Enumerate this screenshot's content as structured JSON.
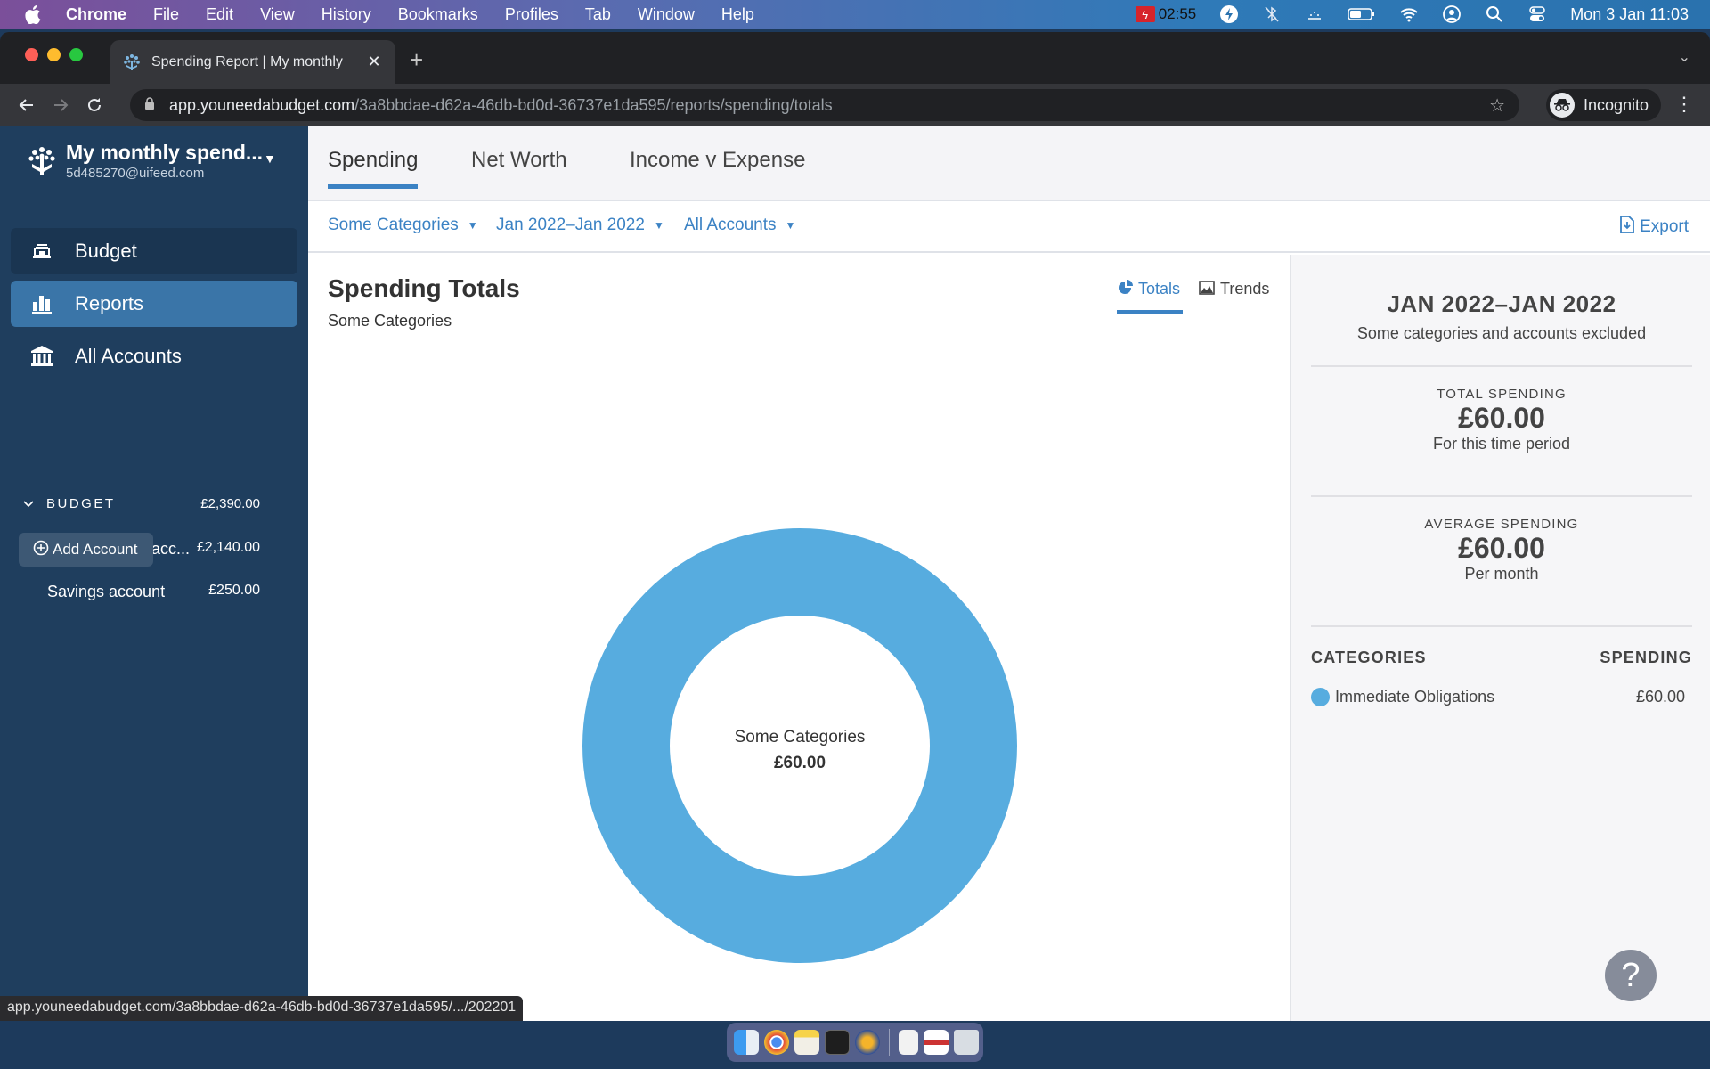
{
  "menubar": {
    "app": "Chrome",
    "items": [
      "File",
      "Edit",
      "View",
      "History",
      "Bookmarks",
      "Profiles",
      "Tab",
      "Window",
      "Help"
    ],
    "recording_time": "02:55",
    "datetime": "Mon 3 Jan  11:03"
  },
  "browser": {
    "tab_title": "Spending Report | My monthly",
    "url_host": "app.youneedabudget.com",
    "url_path": "/3a8bbdae-d62a-46db-bd0d-36737e1da595/reports/spending/totals",
    "profile_label": "Incognito",
    "status_url": "app.youneedabudget.com/3a8bbdae-d62a-46db-bd0d-36737e1da595/.../202201"
  },
  "sidebar": {
    "budget_name": "My monthly spend...",
    "email": "5d485270@uifeed.com",
    "nav": [
      {
        "label": "Budget",
        "icon": "budget-icon"
      },
      {
        "label": "Reports",
        "icon": "bar-chart-icon"
      },
      {
        "label": "All Accounts",
        "icon": "bank-icon"
      }
    ],
    "account_group": {
      "label": "BUDGET",
      "balance": "£2,390.00"
    },
    "accounts": [
      {
        "name": "My main bank acc...",
        "balance": "£2,140.00"
      },
      {
        "name": "Savings account",
        "balance": "£250.00"
      }
    ],
    "add_account_label": "Add Account"
  },
  "report_tabs": [
    {
      "label": "Spending",
      "active": true
    },
    {
      "label": "Net Worth",
      "active": false
    },
    {
      "label": "Income v Expense",
      "active": false
    }
  ],
  "filters": {
    "categories": "Some Categories",
    "date_range": "Jan 2022–Jan 2022",
    "accounts": "All Accounts",
    "export_label": "Export"
  },
  "chart_pane": {
    "title": "Spending Totals",
    "subtitle": "Some Categories",
    "view_toggle": [
      {
        "label": "Totals",
        "active": true
      },
      {
        "label": "Trends",
        "active": false
      }
    ]
  },
  "chart_data": {
    "type": "pie",
    "title": "Spending Totals",
    "subtitle": "Some Categories",
    "center_label": "Some Categories",
    "center_value": "£60.00",
    "donut": true,
    "slices": [
      {
        "label": "Immediate Obligations",
        "value": 60.0,
        "color": "#57acdf"
      }
    ]
  },
  "summary": {
    "range": "JAN 2022–JAN 2022",
    "range_note": "Some categories and accounts excluded",
    "total_label": "TOTAL SPENDING",
    "total_value": "£60.00",
    "total_note": "For this time period",
    "average_label": "AVERAGE SPENDING",
    "average_value": "£60.00",
    "average_note": "Per month",
    "categories_header": "CATEGORIES",
    "spending_header": "SPENDING",
    "categories": [
      {
        "name": "Immediate Obligations",
        "amount": "£60.00",
        "color": "#57acdf"
      }
    ]
  },
  "help_label": "?",
  "colors": {
    "accent": "#3b82c4",
    "sidebar_bg": "#1f3e5e",
    "sidebar_active": "#3a75a8",
    "donut": "#57acdf"
  }
}
